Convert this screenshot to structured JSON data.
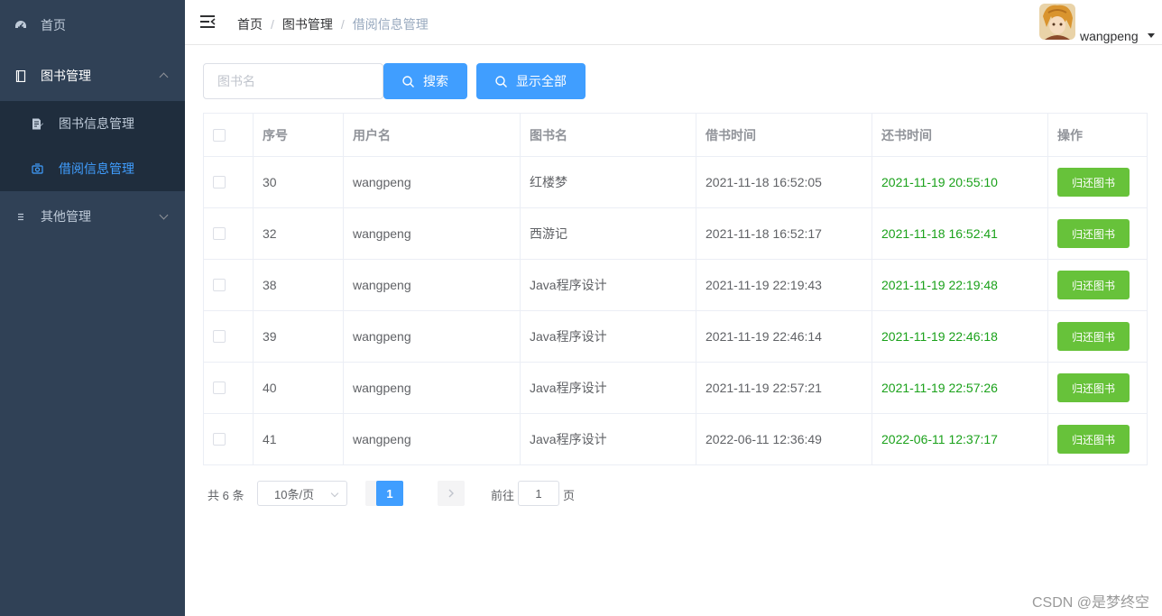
{
  "sidebar": {
    "items": [
      {
        "label": "首页",
        "icon": "dashboard-icon"
      },
      {
        "label": "图书管理",
        "icon": "book-icon",
        "expanded": true,
        "children": [
          {
            "label": "图书信息管理",
            "icon": "document-edit-icon",
            "active": false
          },
          {
            "label": "借阅信息管理",
            "icon": "borrow-icon",
            "active": true
          }
        ]
      },
      {
        "label": "其他管理",
        "icon": "list-icon",
        "expanded": false
      }
    ],
    "colors": {
      "bg": "#304156",
      "submenu_bg": "#1f2d3d",
      "active": "#409eff"
    }
  },
  "header": {
    "breadcrumb": [
      "首页",
      "图书管理",
      "借阅信息管理"
    ],
    "username": "wangpeng"
  },
  "toolbar": {
    "search_placeholder": "图书名",
    "search_value": "",
    "search_label": "搜索",
    "show_all_label": "显示全部"
  },
  "table": {
    "columns": [
      "序号",
      "用户名",
      "图书名",
      "借书时间",
      "还书时间",
      "操作"
    ],
    "rows": [
      {
        "id": "30",
        "user": "wangpeng",
        "book": "红楼梦",
        "borrow_time": "2021-11-18 16:52:05",
        "return_time": "2021-11-19 20:55:10",
        "action": "归还图书"
      },
      {
        "id": "32",
        "user": "wangpeng",
        "book": "西游记",
        "borrow_time": "2021-11-18 16:52:17",
        "return_time": "2021-11-18 16:52:41",
        "action": "归还图书"
      },
      {
        "id": "38",
        "user": "wangpeng",
        "book": "Java程序设计",
        "borrow_time": "2021-11-19 22:19:43",
        "return_time": "2021-11-19 22:19:48",
        "action": "归还图书"
      },
      {
        "id": "39",
        "user": "wangpeng",
        "book": "Java程序设计",
        "borrow_time": "2021-11-19 22:46:14",
        "return_time": "2021-11-19 22:46:18",
        "action": "归还图书"
      },
      {
        "id": "40",
        "user": "wangpeng",
        "book": "Java程序设计",
        "borrow_time": "2021-11-19 22:57:21",
        "return_time": "2021-11-19 22:57:26",
        "action": "归还图书"
      },
      {
        "id": "41",
        "user": "wangpeng",
        "book": "Java程序设计",
        "borrow_time": "2022-06-11 12:36:49",
        "return_time": "2022-06-11 12:37:17",
        "action": "归还图书"
      }
    ],
    "colors": {
      "return_time": "#1aa11a",
      "action_button": "#67c23a"
    }
  },
  "pagination": {
    "total": "共 6 条",
    "page_size": "10条/页",
    "current_page": "1",
    "goto_label": "前往",
    "goto_value": "1",
    "goto_suffix": "页"
  },
  "watermark": "CSDN @是梦终空"
}
